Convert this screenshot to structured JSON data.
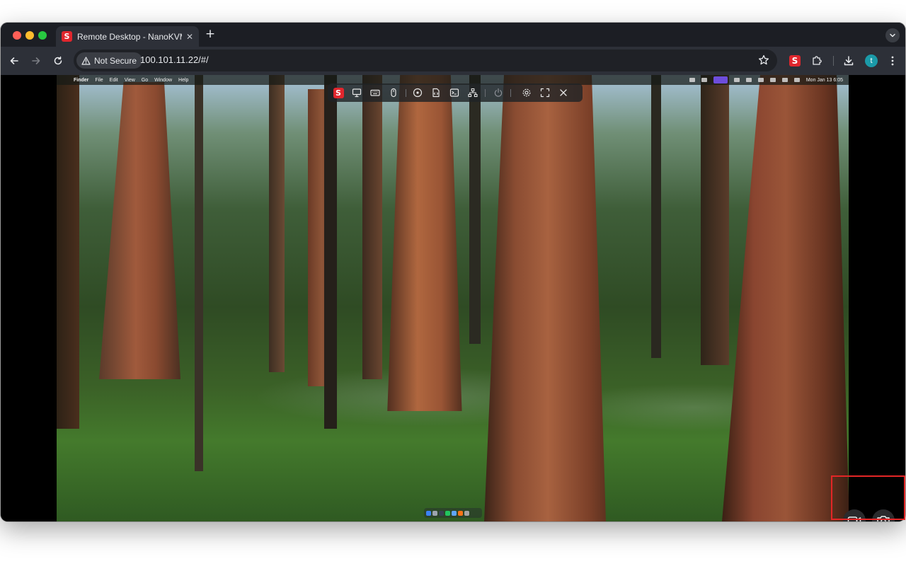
{
  "browser": {
    "tab": {
      "title": "Remote Desktop - NanoKVM",
      "favicon_icon": "nanokvm-logo-icon",
      "favicon_glyph": "S",
      "close_icon": "close-icon"
    },
    "new_tab_icon": "plus-icon",
    "tab_search_icon": "chevron-down-icon",
    "nav": {
      "back_icon": "arrow-left-icon",
      "forward_icon": "arrow-right-icon",
      "reload_icon": "reload-icon"
    },
    "address_bar": {
      "security_label": "Not Secure",
      "security_icon": "warning-triangle-icon",
      "url": "100.101.11.22/#/",
      "bookmark_icon": "star-icon"
    },
    "toolbar_icons": [
      "nanokvm-extension-icon",
      "puzzle-extensions-icon",
      "download-icon",
      "more-vertical-icon"
    ],
    "extension_glyph": "S",
    "profile_initial": "t",
    "colors": {
      "tab_strip": "#1c1e24",
      "toolbar": "#2d3038",
      "omnibox": "#1f2126",
      "avatar": "#1b9aa8",
      "brand_red": "#e0262d"
    }
  },
  "remote": {
    "menubar": {
      "apple_icon": "apple-icon",
      "apple_glyph": "",
      "items": [
        "Finder",
        "File",
        "Edit",
        "View",
        "Go",
        "Window",
        "Help"
      ],
      "clock": "Mon Jan 13  6:05",
      "status_icons": [
        "location-icon",
        "command-icon",
        "screen-mirror-icon",
        "brightness-icon",
        "mute-icon",
        "battery-icon",
        "input-source-icon",
        "wifi-icon",
        "control-center-icon"
      ],
      "highlight_color": "#6d4ddb"
    },
    "kvm_toolbar": {
      "icons": [
        "nanokvm-logo-icon",
        "monitor-icon",
        "keyboard-icon",
        "mouse-icon",
        "virtual-media-icon",
        "script-icon",
        "terminal-icon",
        "network-icon",
        "power-icon",
        "settings-gear-icon",
        "fullscreen-icon",
        "close-icon"
      ],
      "logo_glyph": "S"
    },
    "dock": {
      "icons": [
        "finder-icon",
        "launchpad-icon",
        "app-icon",
        "app-icon",
        "app-icon",
        "app-icon",
        "trash-icon"
      ],
      "colors": [
        "#3b82f6",
        "#9ca3af",
        "#374151",
        "#22c55e",
        "#60a5fa",
        "#f97316",
        "#a3a3a3"
      ]
    }
  },
  "capture_controls": {
    "icons": [
      "video-record-icon",
      "camera-screenshot-icon"
    ],
    "highlight_color": "#e32626"
  }
}
